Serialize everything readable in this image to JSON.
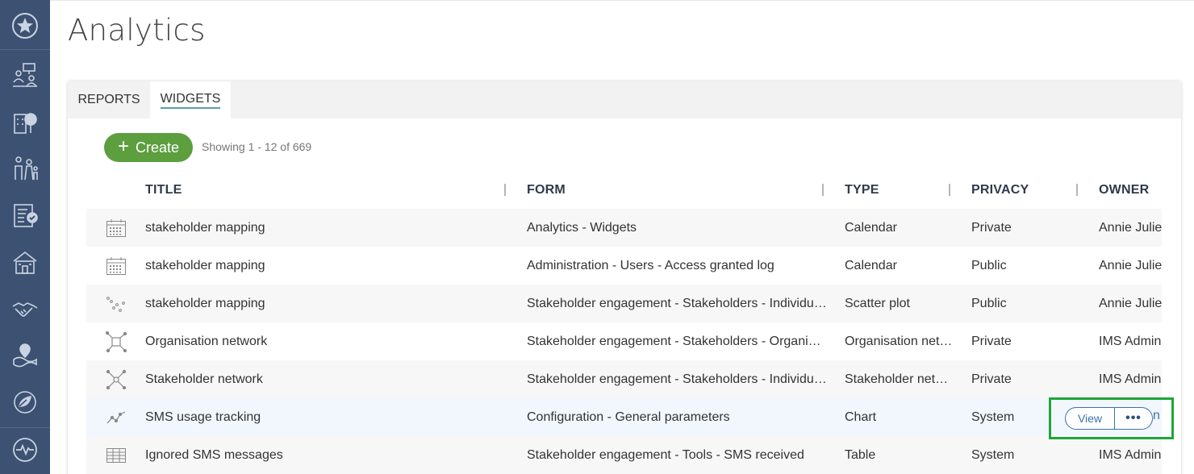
{
  "page": {
    "title": "Analytics"
  },
  "sidebar": {
    "items": [
      {
        "icon": "star-circle-icon"
      },
      {
        "icon": "presentation-people-icon"
      },
      {
        "icon": "building-tree-icon"
      },
      {
        "icon": "family-icon"
      },
      {
        "icon": "checklist-icon"
      },
      {
        "icon": "school-building-icon"
      },
      {
        "icon": "handshake-icon"
      },
      {
        "icon": "map-pin-icon"
      },
      {
        "icon": "leaf-hand-icon"
      },
      {
        "icon": "pulse-icon"
      }
    ]
  },
  "tabs": [
    {
      "label": "REPORTS",
      "active": false
    },
    {
      "label": "WIDGETS",
      "active": true
    }
  ],
  "toolbar": {
    "create_label": "Create",
    "showing_text": "Showing 1 - 12 of 669"
  },
  "table": {
    "columns": [
      "TITLE",
      "FORM",
      "TYPE",
      "PRIVACY",
      "OWNER"
    ],
    "rows": [
      {
        "icon": "calendar-icon",
        "title": "stakeholder mapping",
        "form": "Analytics - Widgets",
        "type": "Calendar",
        "privacy": "Private",
        "owner": "Annie Julien"
      },
      {
        "icon": "calendar-icon",
        "title": "stakeholder mapping",
        "form": "Administration - Users - Access granted log",
        "type": "Calendar",
        "privacy": "Public",
        "owner": "Annie Julien"
      },
      {
        "icon": "scatter-icon",
        "title": "stakeholder mapping",
        "form": "Stakeholder engagement - Stakeholders - Individuals",
        "type": "Scatter plot",
        "privacy": "Public",
        "owner": "Annie Julien"
      },
      {
        "icon": "network-icon",
        "title": "Organisation network",
        "form": "Stakeholder engagement - Stakeholders - Organisat…",
        "type": "Organisation net…",
        "privacy": "Private",
        "owner": "IMS Admin"
      },
      {
        "icon": "network-icon",
        "title": "Stakeholder network",
        "form": "Stakeholder engagement - Stakeholders - Individuals",
        "type": "Stakeholder netw…",
        "privacy": "Private",
        "owner": "IMS Admin"
      },
      {
        "icon": "line-chart-icon",
        "title": "SMS usage tracking",
        "form": "Configuration - General parameters",
        "type": "Chart",
        "privacy": "System",
        "owner": ""
      },
      {
        "icon": "table-icon",
        "title": "Ignored SMS messages",
        "form": "Stakeholder engagement - Tools - SMS received",
        "type": "Table",
        "privacy": "System",
        "owner": "IMS Admin"
      }
    ]
  },
  "row_actions": {
    "view_label": "View",
    "more_label": "•••",
    "owner_tail": "n"
  },
  "colors": {
    "sidebar": "#3d5272",
    "create_button": "#5d9e3f",
    "action_blue": "#3b72a8",
    "highlight_box": "#1ea53a"
  }
}
